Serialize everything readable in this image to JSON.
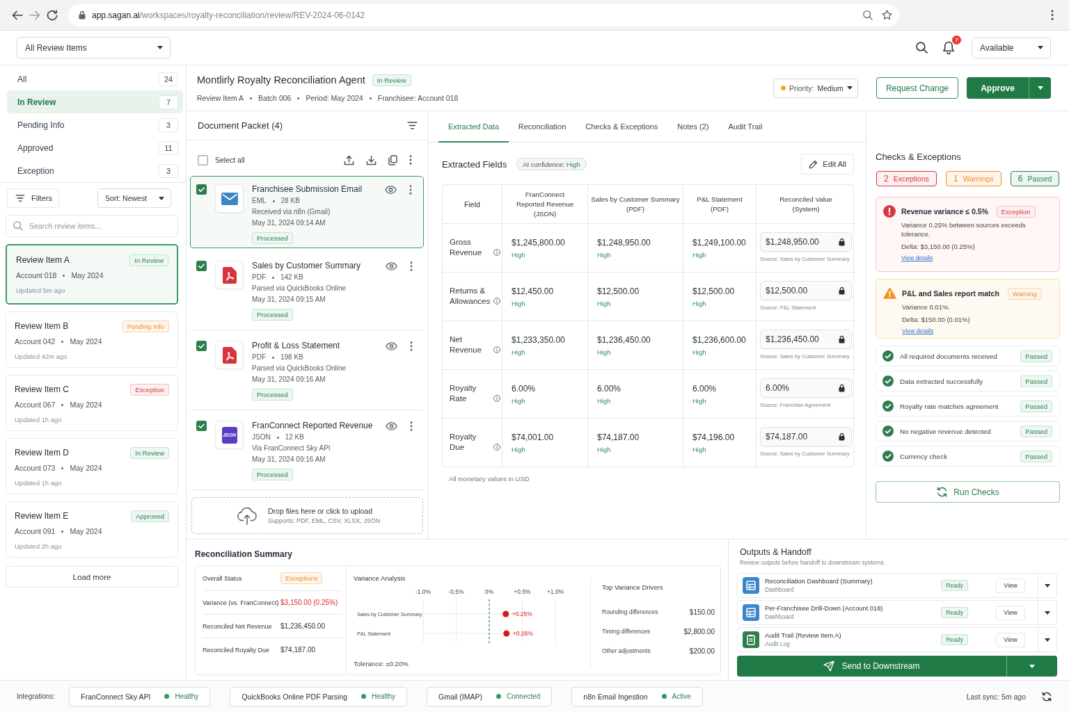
{
  "browser": {
    "url_host": "app.sagan.ai",
    "url_path": "/workspaces/royalty-reconciliation/review/REV-2024-06-0142"
  },
  "top_bar": {
    "view_select": "All Review Items",
    "notification_count": "7",
    "status_select": "Available"
  },
  "sidebar": {
    "statuses": [
      {
        "label": "All",
        "count": "24",
        "selected": false
      },
      {
        "label": "In Review",
        "count": "7",
        "selected": true
      },
      {
        "label": "Pending Info",
        "count": "3",
        "selected": false
      },
      {
        "label": "Approved",
        "count": "11",
        "selected": false
      },
      {
        "label": "Exception",
        "count": "3",
        "selected": false
      }
    ],
    "filters_button": "Filters",
    "sort_select": "Sort: Newest",
    "search": {
      "placeholder": "Search review items..."
    },
    "review_items": [
      {
        "title": "Review Item A",
        "badge": {
          "label": "In Review",
          "kind": "review"
        },
        "meta": [
          "Account 018",
          "May 2024"
        ],
        "updated": "Updated 5m ago",
        "selected": true
      },
      {
        "title": "Review Item B",
        "badge": {
          "label": "Pending Info",
          "kind": "pending"
        },
        "meta": [
          "Account 042",
          "May 2024"
        ],
        "updated": "Updated 42m ago",
        "selected": false
      },
      {
        "title": "Review Item C",
        "badge": {
          "label": "Exception",
          "kind": "exception"
        },
        "meta": [
          "Account 067",
          "May 2024"
        ],
        "updated": "Updated 1h ago",
        "selected": false
      },
      {
        "title": "Review Item D",
        "badge": {
          "label": "In Review",
          "kind": "review"
        },
        "meta": [
          "Account 073",
          "May 2024"
        ],
        "updated": "Updated 1h ago",
        "selected": false
      },
      {
        "title": "Review Item E",
        "badge": {
          "label": "Approved",
          "kind": "approved"
        },
        "meta": [
          "Account 091",
          "May 2024"
        ],
        "updated": "Updated 2h ago",
        "selected": false
      }
    ],
    "load_more": "Load more"
  },
  "header": {
    "title": "Montlirly Royalty Reconciliation Agent",
    "badge": {
      "label": "In Review",
      "kind": "review"
    },
    "meta": [
      "Review Item A",
      "Batch 006",
      "Period: May 2024",
      "Franchisee: Account 018"
    ],
    "priority": {
      "label": "Priority:",
      "value": "Medium"
    },
    "request_change": "Request Change",
    "approve": "Approve"
  },
  "document_packet": {
    "title": "Document Packet (4)",
    "select_all": {
      "label": "Select all",
      "checked": false
    },
    "documents": [
      {
        "kind": "email",
        "name": "Franchisee Submission Email",
        "type": "EML",
        "size": "28 KB",
        "source": "Received via n8n (Gmail)",
        "date": "May 31, 2024 09:14 AM",
        "status": "Processed",
        "checked": true,
        "selected": true
      },
      {
        "kind": "pdf",
        "name": "Sales by Customer Summary",
        "type": "PDF",
        "size": "142 KB",
        "source": "Parsed via QuickBooks Online",
        "date": "May 31, 2024 09:15 AM",
        "status": "Processed",
        "checked": true,
        "selected": false
      },
      {
        "kind": "pdf",
        "name": "Profit & Loss Statement",
        "type": "PDF",
        "size": "198 KB",
        "source": "Parsed via QuickBooks Online",
        "date": "May 31, 2024 09:16 AM",
        "status": "Processed",
        "checked": true,
        "selected": false
      },
      {
        "kind": "json",
        "icon_label": "JSON",
        "name": "FranConnect Reported Revenue",
        "type": "JSON",
        "size": "12 KB",
        "source": "Via FranConnect Sky API",
        "date": "May 31, 2024 09:16 AM",
        "status": "Processed",
        "checked": true,
        "selected": false
      }
    ],
    "dropzone": {
      "title": "Drop files here or click to upload",
      "hint": "Supports: PDF, EML, CSV, XLSX, JSON"
    }
  },
  "tabs": [
    {
      "label": "Extracted Data",
      "selected": true
    },
    {
      "label": "Reconciliation",
      "selected": false
    },
    {
      "label": "Checks & Exceptions",
      "selected": false
    },
    {
      "label": "Notes (2)",
      "selected": false
    },
    {
      "label": "Audit Trail",
      "selected": false
    }
  ],
  "extracted_fields": {
    "title": "Extracted Fields",
    "confidence": {
      "label": "AI confidence:",
      "value": "High"
    },
    "edit_button": "Edit All",
    "columns": [
      {
        "title": "Field"
      },
      {
        "title": "FranConnect Reported Revenue",
        "subtitle": "(JSON)"
      },
      {
        "title": "Sales by Customer Summary",
        "subtitle": "(PDF)"
      },
      {
        "title": "P&L Statement",
        "subtitle": "(PDF)"
      },
      {
        "title": "Reconciled Value",
        "subtitle": "(System)"
      }
    ],
    "rows": [
      {
        "field": "Gross Revenue",
        "values": [
          {
            "value": "$1,245,800.00",
            "confidence": "High"
          },
          {
            "value": "$1,248,950.00",
            "confidence": "High"
          },
          {
            "value": "$1,249,100.00",
            "confidence": "High"
          }
        ],
        "reconciled": "$1,248,950.00",
        "source": "Source: Sales by Customer Summary"
      },
      {
        "field": "Returns & Allowances",
        "values": [
          {
            "value": "$12,450.00",
            "confidence": "High"
          },
          {
            "value": "$12,500.00",
            "confidence": "High"
          },
          {
            "value": "$12,500.00",
            "confidence": "High"
          }
        ],
        "reconciled": "$12,500.00",
        "source": "Source: P&L Statement"
      },
      {
        "field": "Net Revenue",
        "values": [
          {
            "value": "$1,233,350.00",
            "confidence": "High"
          },
          {
            "value": "$1,236,450.00",
            "confidence": "High"
          },
          {
            "value": "$1,236,600.00",
            "confidence": "High"
          }
        ],
        "reconciled": "$1,236,450.00",
        "source": "Source: Sales by Customer Summary"
      },
      {
        "field": "Royalty Rate",
        "values": [
          {
            "value": "6.00%",
            "confidence": "High"
          },
          {
            "value": "6.00%",
            "confidence": "High"
          },
          {
            "value": "6.00%",
            "confidence": "High"
          }
        ],
        "reconciled": "6.00%",
        "source": "Source: Franchise Agreement"
      },
      {
        "field": "Royalty Due",
        "values": [
          {
            "value": "$74,001.00",
            "confidence": "High"
          },
          {
            "value": "$74,187.00",
            "confidence": "High"
          },
          {
            "value": "$74,196.00",
            "confidence": "High"
          }
        ],
        "reconciled": "$74,187.00",
        "source": "Source: Sales by Customer Summary"
      }
    ],
    "footnote": "All monetary values in USD"
  },
  "checks": {
    "title": "Checks & Exceptions",
    "summary": [
      {
        "kind": "exception",
        "count": "2",
        "label": "Exceptions"
      },
      {
        "kind": "warning",
        "count": "1",
        "label": "Warnings"
      },
      {
        "kind": "passed",
        "count": "6",
        "label": "Passed"
      }
    ],
    "items": [
      {
        "kind": "exception",
        "title": "Revenue variance ≤ 0.5%",
        "badge": "Exception",
        "description": "Variance 0.25% between sources exceeds tolerance.",
        "delta": "Delta: $3,150.00 (0.25%)",
        "link": "View details"
      },
      {
        "kind": "warning",
        "title": "P&L and Sales report match",
        "badge": "Warning",
        "description": "Variance 0.01%.",
        "delta": "Delta: $150.00 (0.01%)",
        "link": "View details"
      },
      {
        "kind": "passed",
        "title": "All required documents received",
        "badge": "Passed"
      },
      {
        "kind": "passed",
        "title": "Data extracted successfully",
        "badge": "Passed"
      },
      {
        "kind": "passed",
        "title": "Royalty rate matches agreement",
        "badge": "Passed"
      },
      {
        "kind": "passed",
        "title": "No negative revenue detected",
        "badge": "Passed"
      },
      {
        "kind": "passed",
        "title": "Currency check",
        "badge": "Passed"
      }
    ],
    "run_button": "Run Checks"
  },
  "reconciliation_summary": {
    "title": "Reconciliation Summary",
    "overall_status": {
      "label": "Overall Status",
      "badge": "Exceptions"
    },
    "figures": [
      {
        "label": "Variance (vs. FranConnect)",
        "value": "$3,150.00 (0.25%)",
        "alert": true
      },
      {
        "label": "Reconciled Net Revenue",
        "value": "$1,236,450.00",
        "alert": false
      },
      {
        "label": "Reconciled Royalty Due",
        "value": "$74,187.00",
        "alert": false
      }
    ],
    "variance_analysis": {
      "chart_data": {
        "type": "scatter",
        "title": "Variance Analysis",
        "orientation": "horizontal",
        "categories": [
          "Sales by Customer Summary",
          "P&L Statement"
        ],
        "values": [
          0.25,
          0.26
        ],
        "xlim": [
          -1,
          1
        ],
        "xticks": [
          {
            "value": -1,
            "label": "-1.0%"
          },
          {
            "value": -0.5,
            "label": "-0.5%"
          },
          {
            "value": 0,
            "label": "0%"
          },
          {
            "value": 0.5,
            "label": "+0.5%"
          },
          {
            "value": 1,
            "label": "+1.0%"
          }
        ],
        "grid": true,
        "value_labels": [
          "+0.25%",
          "+0.26%"
        ],
        "ref_lines": [
          {
            "axis": "x",
            "value": 0
          }
        ]
      },
      "tolerance": "Tolerance: ±0.20%"
    },
    "drivers": {
      "title": "Top Variance Drivers",
      "items": [
        {
          "label": "Rounding differences",
          "value": "$150.00"
        },
        {
          "label": "Timing differences",
          "value": "$2,800.00"
        },
        {
          "label": "Other adjustments",
          "value": "$200.00"
        }
      ]
    }
  },
  "outputs": {
    "title": "Outputs & Handoff",
    "subtitle": "Review outputs before handoff to downstream systems.",
    "items": [
      {
        "kind": "dashboard",
        "name": "Reconciliation Dashboard (Summary)",
        "type": "Dashboard",
        "status": "Ready",
        "action": "View"
      },
      {
        "kind": "dashboard",
        "name": "Per-Franchisee Drill-Down (Account 018)",
        "type": "Dashboard",
        "status": "Ready",
        "action": "View"
      },
      {
        "kind": "log",
        "name": "Audit Trail (Review Item A)",
        "type": "Audit Log",
        "status": "Ready",
        "action": "View"
      }
    ],
    "send_button": "Send to Downstream"
  },
  "integrations": {
    "label": "Integrations:",
    "items": [
      {
        "name": "FranConnect Sky API",
        "status": "Healthy"
      },
      {
        "name": "QuickBooks Online PDF Parsing",
        "status": "Healthy"
      },
      {
        "name": "Gmail (IMAP)",
        "status": "Connected"
      },
      {
        "name": "n8n Email Ingestion",
        "status": "Active"
      }
    ],
    "last_sync": "Last sync: 5m ago"
  }
}
